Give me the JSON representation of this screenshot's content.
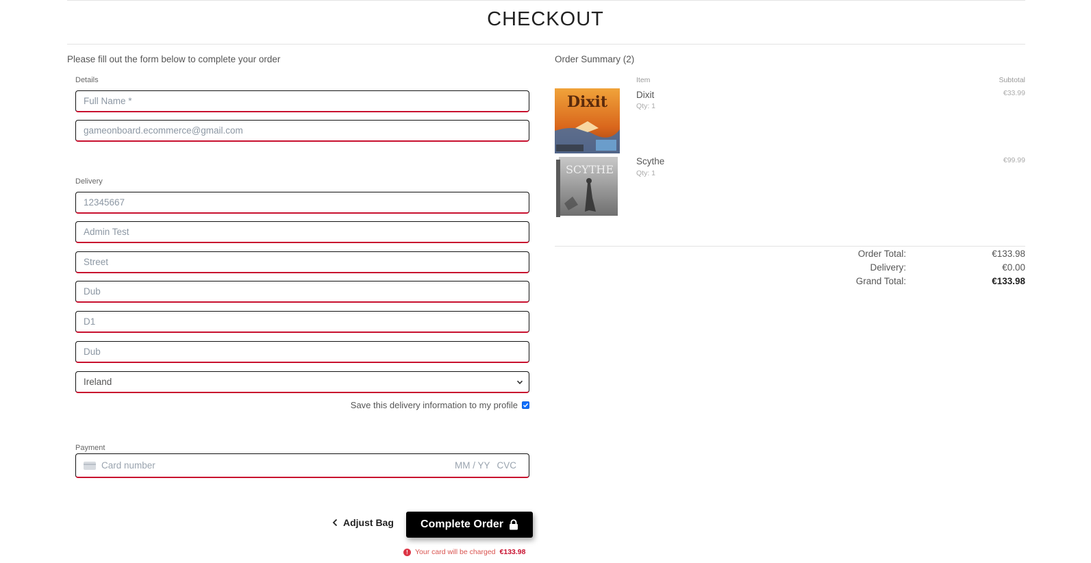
{
  "page": {
    "title": "CHECKOUT"
  },
  "form": {
    "lead": "Please fill out the form below to complete your order",
    "details_label": "Details",
    "full_name_placeholder": "Full Name *",
    "email_value": "gameonboard.ecommerce@gmail.com",
    "delivery_label": "Delivery",
    "phone_value": "12345667",
    "address1_value": "Admin Test",
    "street_value": "Street",
    "town_value": "Dub",
    "postcode_value": "D1",
    "county_value": "Dub",
    "country_value": "Ireland",
    "save_info_label": "Save this delivery information to my profile",
    "save_info_checked": true,
    "payment_label": "Payment",
    "card_number_placeholder": "Card number",
    "card_expiry_placeholder": "MM / YY",
    "card_cvc_placeholder": "CVC"
  },
  "actions": {
    "adjust_bag_label": "Adjust Bag",
    "complete_order_label": "Complete Order",
    "charge_note_prefix": "Your card will be charged",
    "charge_amount": "€133.98"
  },
  "summary": {
    "title": "Order Summary (2)",
    "item_header": "Item",
    "subtotal_header": "Subtotal",
    "items": [
      {
        "name": "Dixit",
        "qty": "Qty: 1",
        "subtotal": "€33.99",
        "image_icon": "dixit-box-icon"
      },
      {
        "name": "Scythe",
        "qty": "Qty: 1",
        "subtotal": "€99.99",
        "image_icon": "scythe-box-icon"
      }
    ],
    "order_total_label": "Order Total:",
    "order_total_value": "€133.98",
    "delivery_label": "Delivery:",
    "delivery_value": "€0.00",
    "grand_total_label": "Grand Total:",
    "grand_total_value": "€133.98"
  },
  "colors": {
    "accent": "#c8102e",
    "button": "#000000",
    "checkbox": "#0d6efd"
  }
}
